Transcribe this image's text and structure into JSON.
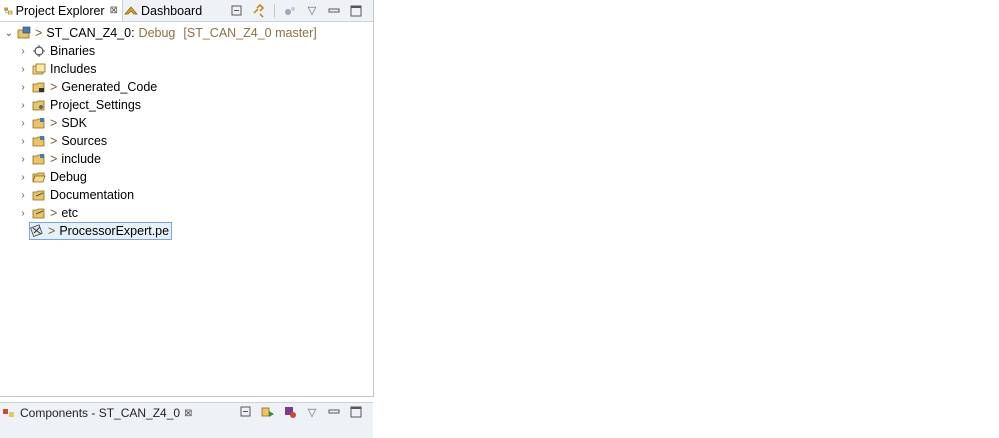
{
  "tabs": [
    {
      "label": "Project Explorer",
      "icon": "project-explorer-icon",
      "close": "⊠"
    },
    {
      "label": "Dashboard",
      "icon": "dashboard-icon"
    }
  ],
  "toolbar": {
    "icons": [
      "collapse-all-icon",
      "link-with-editor-icon",
      "filter-icon",
      "view-menu-icon",
      "minimize-icon",
      "maximize-icon"
    ]
  },
  "tree": {
    "root": {
      "prefix": ">",
      "label": "ST_CAN_Z4_0:",
      "decoration": "Debug",
      "repo": "[ST_CAN_Z4_0 master]"
    },
    "items": [
      {
        "prefix": "",
        "label": "Binaries",
        "icon": "binaries-icon"
      },
      {
        "prefix": "",
        "label": "Includes",
        "icon": "includes-icon"
      },
      {
        "prefix": ">",
        "label": "Generated_Code",
        "icon": "folder-icon"
      },
      {
        "prefix": "",
        "label": "Project_Settings",
        "icon": "folder-settings-icon"
      },
      {
        "prefix": ">",
        "label": "SDK",
        "icon": "folder-icon"
      },
      {
        "prefix": ">",
        "label": "Sources",
        "icon": "folder-icon"
      },
      {
        "prefix": ">",
        "label": "include",
        "icon": "folder-icon"
      },
      {
        "prefix": "",
        "label": "Debug",
        "icon": "open-folder-icon"
      },
      {
        "prefix": "",
        "label": "Documentation",
        "icon": "doc-folder-icon"
      },
      {
        "prefix": ">",
        "label": "etc",
        "icon": "doc-folder-icon"
      },
      {
        "prefix": ">",
        "label": "ProcessorExpert.pe",
        "icon": "pe-file-icon"
      }
    ]
  },
  "bottom": {
    "tab_label": "Components - ST_CAN_Z4_0",
    "close": "⊠"
  },
  "colors": {
    "tabbar": "#eef2f7",
    "selection": "#e5f0fb",
    "decoration": "#8f6f44"
  }
}
